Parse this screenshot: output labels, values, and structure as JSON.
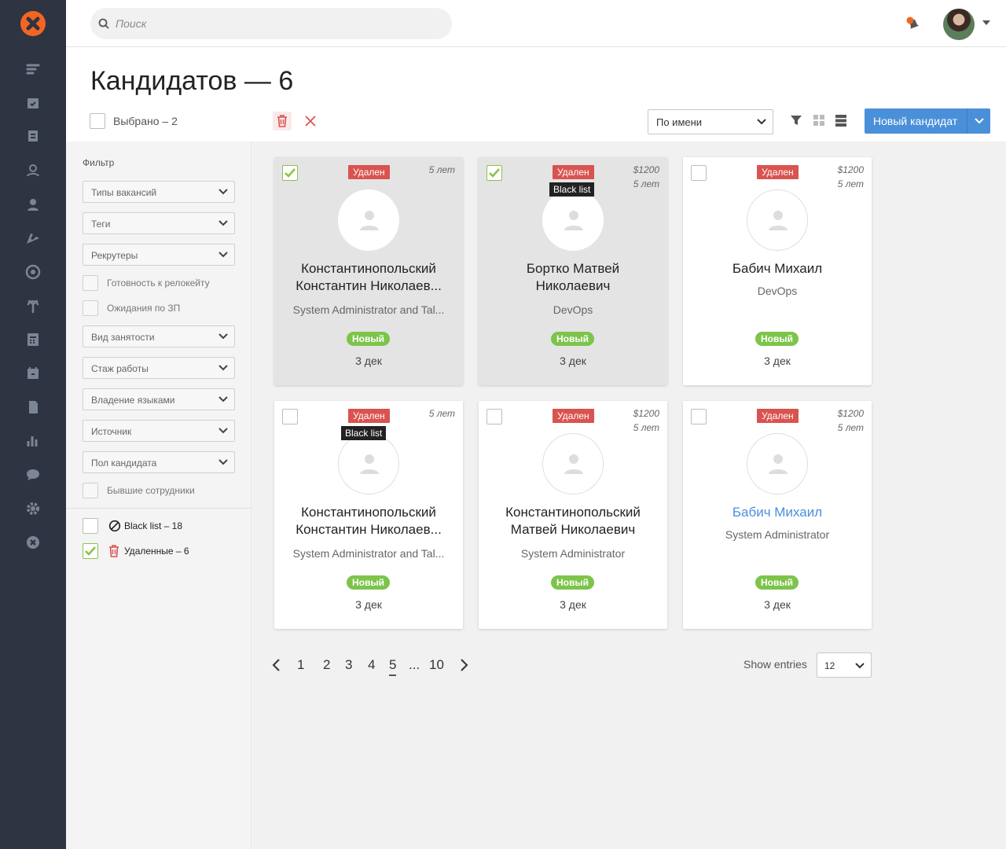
{
  "search": {
    "placeholder": "Поиск"
  },
  "page": {
    "title": "Кандидатов — 6",
    "selected_label": "Выбрано – 2"
  },
  "toolbar": {
    "sort_value": "По имени",
    "new_button": "Новый кандидат"
  },
  "filters": {
    "title": "Фильтр",
    "selects": [
      "Типы вакансий",
      "Теги",
      "Рекрутеры"
    ],
    "checks_a": [
      "Готовность к релокейту",
      "Ожидания по ЗП"
    ],
    "selects_b": [
      "Вид занятости",
      "Стаж работы",
      "Владение языками",
      "Источник",
      "Пол кандидата"
    ],
    "checks_b": [
      "Бывшие сотрудники"
    ],
    "blacklist": "Black list – 18",
    "deleted": "Удаленные – 6"
  },
  "cards": [
    {
      "status": "Удален",
      "salary": "",
      "experience": "5 лет",
      "blacklist": "",
      "name_line1": "Константинопольский",
      "name_line2": "Константин Николаев...",
      "position": "System Administrator and Tal...",
      "stage": "Новый",
      "date": "3 дек",
      "selected": true
    },
    {
      "status": "Удален",
      "salary": "$1200",
      "experience": "5 лет",
      "blacklist": "Black list",
      "name_line1": "Бортко Матвей",
      "name_line2": "Николаевич",
      "position": "DevOps",
      "stage": "Новый",
      "date": "3 дек",
      "selected": true
    },
    {
      "status": "Удален",
      "salary": "$1200",
      "experience": "5 лет",
      "blacklist": "",
      "name_line1": "Бабич Михаил",
      "name_line2": "",
      "position": "DevOps",
      "stage": "Новый",
      "date": "3 дек",
      "selected": false
    },
    {
      "status": "Удален",
      "salary": "",
      "experience": "5 лет",
      "blacklist": "Black list",
      "name_line1": "Константинопольский",
      "name_line2": "Константин Николаев...",
      "position": "System Administrator and Tal...",
      "stage": "Новый",
      "date": "3 дек",
      "selected": false
    },
    {
      "status": "Удален",
      "salary": "$1200",
      "experience": "5 лет",
      "blacklist": "",
      "name_line1": "Константинопольский",
      "name_line2": "Матвей Николаевич",
      "position": "System Administrator",
      "stage": "Новый",
      "date": "3 дек",
      "selected": false
    },
    {
      "status": "Удален",
      "salary": "$1200",
      "experience": "5 лет",
      "blacklist": "",
      "name_line1": "Бабич Михаил",
      "name_line2": "",
      "position": "System Administrator",
      "stage": "Новый",
      "date": "3 дек",
      "selected": false
    }
  ],
  "pagination": {
    "pages": [
      "1",
      "2",
      "3",
      "4",
      "5",
      "...",
      "10"
    ],
    "current": "5"
  },
  "entries": {
    "label": "Show entries",
    "value": "12"
  },
  "colors": {
    "nav_bg": "#2e3441",
    "accent": "#4a90d9",
    "danger": "#d9534f",
    "success": "#7cc44a",
    "brand": "#f26522"
  }
}
